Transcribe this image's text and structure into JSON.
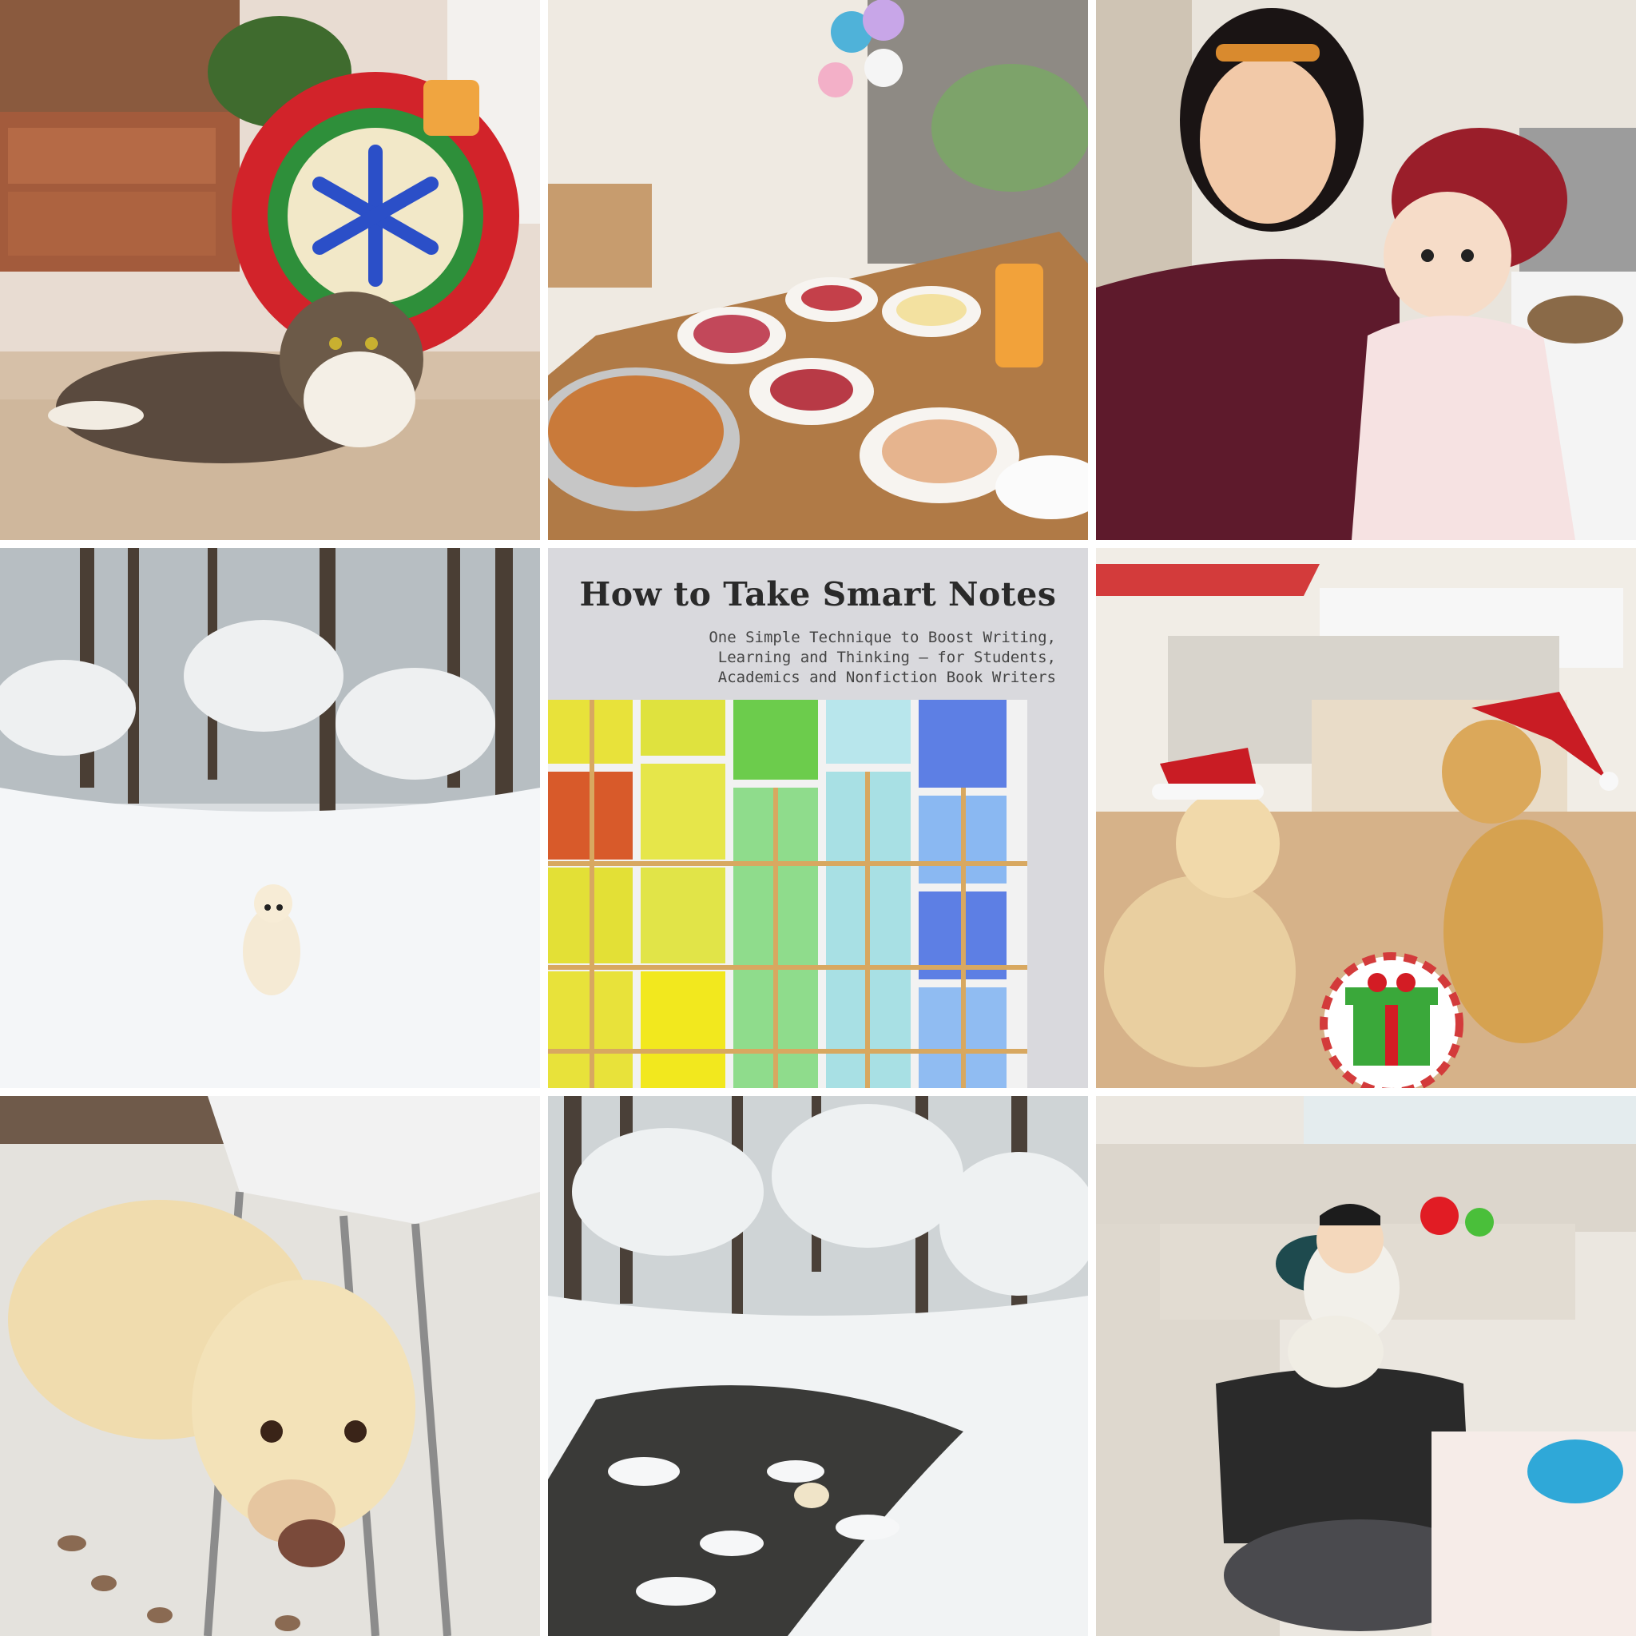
{
  "collage": {
    "book": {
      "title": "How to Take Smart Notes",
      "subtitle_lines": [
        "One Simple Technique to Boost Writing,",
        "Learning and Thinking – for Students,",
        "Academics and Nonfiction Book Writers"
      ]
    }
  }
}
